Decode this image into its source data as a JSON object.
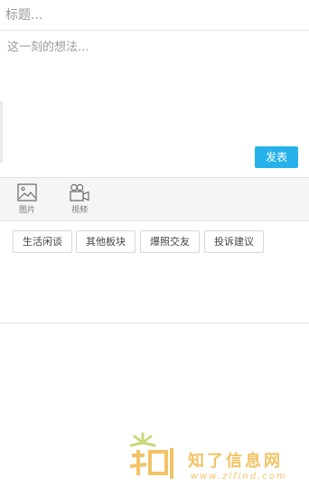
{
  "form": {
    "title_placeholder": "标题...",
    "body_placeholder": "这一刻的想法...",
    "publish_label": "发表"
  },
  "attachments": {
    "picture_label": "图片",
    "video_label": "视频"
  },
  "tags": [
    "生活闲谈",
    "其他板块",
    "爆照交友",
    "投诉建议"
  ],
  "watermark": {
    "logo_text": "知了信息网",
    "url_text": "www.zlfind.com"
  },
  "colors": {
    "accent": "#27b1ea",
    "watermark": "#f1b43f"
  }
}
